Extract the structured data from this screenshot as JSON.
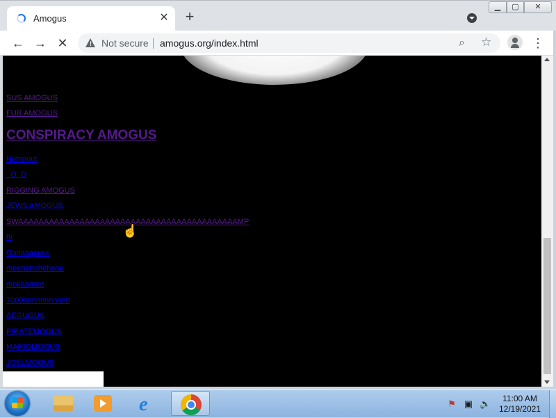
{
  "browser": {
    "tab_title": "Amogus",
    "tab_close": "✕",
    "new_tab": "+",
    "security_label": "Not secure",
    "url": "amogus.org/index.html",
    "window_controls": {
      "minimize": "▁",
      "maximize": "▢",
      "close": "✕"
    }
  },
  "toolbar": {
    "back": "←",
    "forward": "→",
    "stop": "✕",
    "zoom": "⌕",
    "star": "☆",
    "menu": "⋮"
  },
  "page": {
    "links": [
      {
        "text": "SUS AMOGUS",
        "style": "purple"
      },
      {
        "text": "FUR AMOGUS",
        "style": "purple"
      },
      {
        "text": "CONSPIRACY AMOGUS",
        "style": "purple-heading"
      },
      {
        "text": "Notsmad",
        "style": "blue"
      },
      {
        "text": "_O_O",
        "style": "blue"
      },
      {
        "text": "RIGGING AMOGUS",
        "style": "purple"
      },
      {
        "text": "JEWS AMOGUS",
        "style": "blue"
      },
      {
        "text": "SWAAAAAAAAAAAAAAAAAAAAAAAAAAAAAAAAAAAAAAAAAAAMP",
        "style": "purple"
      },
      {
        "text": "hi",
        "style": "blue"
      },
      {
        "text": "Gahaagouss",
        "style": "blue"
      },
      {
        "text": "meehehahehehe",
        "style": "blue"
      },
      {
        "text": "mokaamoo",
        "style": "blue"
      },
      {
        "text": "7000onnnnnnnnnn",
        "style": "blue"
      },
      {
        "text": "AEGUGUS",
        "style": "blue"
      },
      {
        "text": "PIRATEMOGUS",
        "style": "blue"
      },
      {
        "text": "MARIOMOGUS",
        "style": "blue"
      },
      {
        "text": "JOELMOGUS",
        "style": "blue"
      }
    ]
  },
  "taskbar": {
    "clock_time": "11:00 AM",
    "clock_date": "12/19/2021",
    "tray": {
      "flag": "⚑",
      "network": "▣",
      "volume": "🔈"
    }
  }
}
